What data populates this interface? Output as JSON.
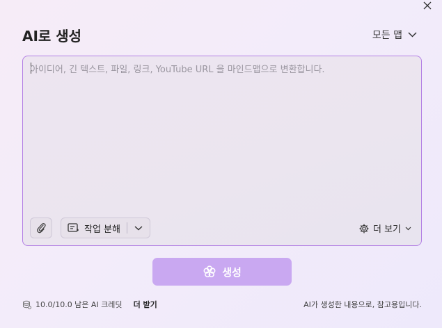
{
  "dialog": {
    "title": "AI로 생성",
    "map_type": "모든 맵",
    "close_icon": "close-icon"
  },
  "editor": {
    "placeholder": "아이디어, 긴 텍스트, 파일, 링크, YouTube URL 을 마인드맵으로 변환합니다.",
    "value": "",
    "attach_icon": "paperclip-icon",
    "task_button_label": "작업 분해",
    "task_icon": "task-split-icon",
    "more_label": "더 보기",
    "more_icon": "gear-icon"
  },
  "generate": {
    "label": "생성",
    "icon": "flower-icon"
  },
  "footer": {
    "credits_text": "10.0/10.0 남은 AI 크레딧",
    "get_more_label": "더 받기",
    "disclaimer": "AI가 생성한 내용으로, 참고용입니다."
  },
  "colors": {
    "accent": "#b27ee4",
    "generate_button": "#c9a8f1"
  }
}
